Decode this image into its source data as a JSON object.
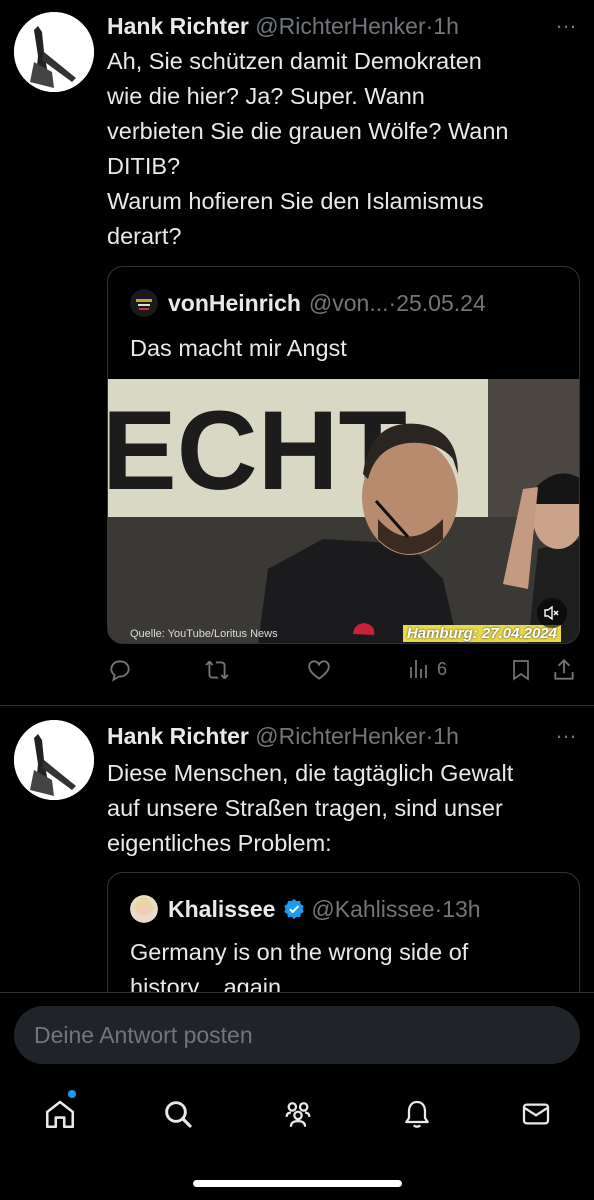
{
  "tweets": [
    {
      "author": {
        "name": "Hank Richter",
        "handle": "@RichterHenker",
        "time": "1h"
      },
      "separator": "·",
      "more_icon": "…",
      "text": "Ah, Sie schützen damit Demokraten\nwie die hier? Ja? Super. Wann\nverbieten Sie die grauen Wölfe? Wann\nDITIB?\nWarum hofieren Sie den Islamismus\nderart?",
      "quote": {
        "author": {
          "name": "vonHeinrich",
          "handle": "@von...",
          "time": "25.05.24"
        },
        "text": "Das macht mir Angst",
        "video": {
          "banner_text": "ECHT",
          "source_caption": "Quelle: YouTube/Loritus News",
          "location_caption": "Hamburg: 27.04.2024",
          "mute_icon": "speaker-muted-icon"
        }
      },
      "actions": {
        "reply": "",
        "retweet": "",
        "like": "",
        "views": "6",
        "bookmark": "",
        "share": ""
      }
    },
    {
      "author": {
        "name": "Hank Richter",
        "handle": "@RichterHenker",
        "time": "1h"
      },
      "separator": "·",
      "more_icon": "…",
      "text": "Diese Menschen, die tagtäglich Gewalt\nauf unsere Straßen tragen, sind unser\neigentliches Problem:",
      "quote": {
        "author": {
          "name": "Khalissee",
          "handle": "@Kahlissee",
          "time": "13h",
          "verified": true
        },
        "text": "Germany is on the wrong side of\nhistory... again."
      }
    }
  ],
  "reply_box": {
    "placeholder": "Deine Antwort posten"
  },
  "tabbar": {
    "items": [
      "home-icon",
      "search-icon",
      "communities-icon",
      "notifications-icon",
      "messages-icon"
    ],
    "home_notification_dot": true
  },
  "colors": {
    "background": "#000000",
    "text": "#e7e9ea",
    "muted": "#71767b",
    "accent": "#1d9bf0",
    "border": "#2f3336",
    "input": "#202327"
  }
}
